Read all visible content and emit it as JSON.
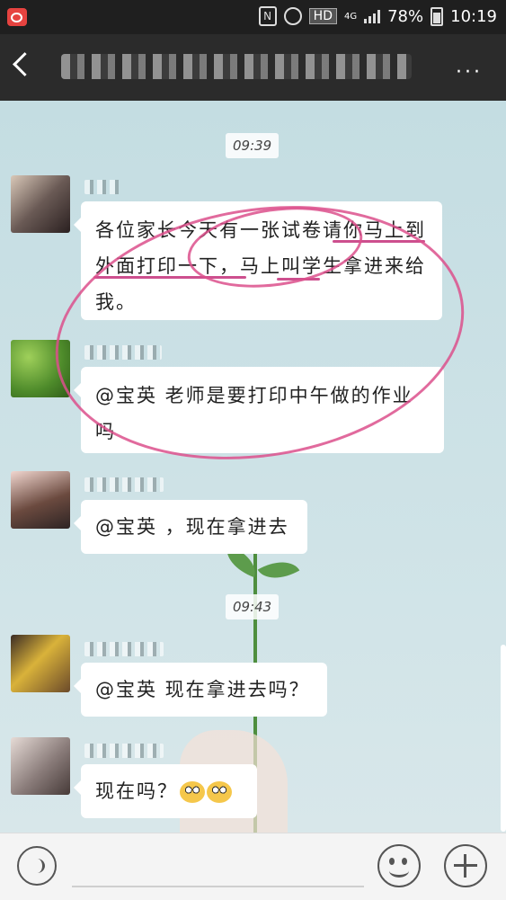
{
  "status_bar": {
    "network": "4G",
    "battery": "78%",
    "time": "10:19",
    "hd_label": "HD",
    "nfc_label": "N"
  },
  "header": {
    "more_label": "···"
  },
  "chat": {
    "timestamps": [
      "09:39",
      "09:43"
    ],
    "messages": [
      {
        "text": "各位家长今天有一张试卷请你马上到外面打印一下，马上叫学生拿进来给我。"
      },
      {
        "text": "@宝英 老师是要打印中午做的作业吗"
      },
      {
        "text": "@宝英 ，现在拿进去"
      },
      {
        "text": "@宝英 现在拿进去吗？"
      },
      {
        "text": "现在吗？"
      }
    ],
    "colors": {
      "annotation": "#dc508c",
      "bubble": "#ffffff"
    }
  },
  "input_bar": {
    "icons": [
      "voice-icon",
      "emoji-icon",
      "plus-icon"
    ]
  }
}
